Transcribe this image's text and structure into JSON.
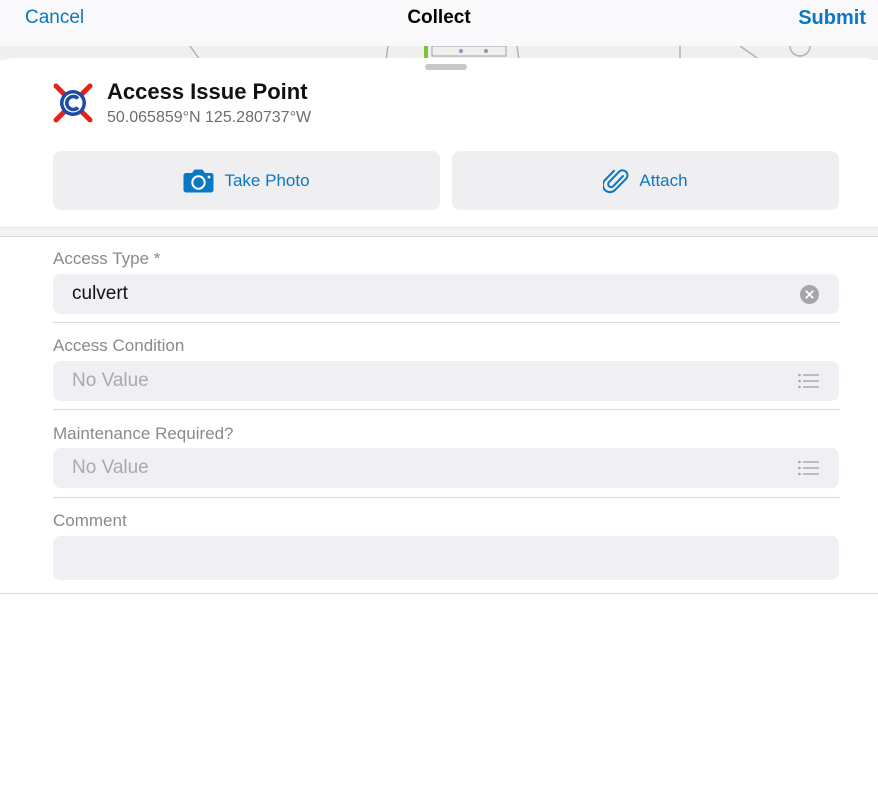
{
  "navbar": {
    "cancel_label": "Cancel",
    "title": "Collect",
    "submit_label": "Submit"
  },
  "feature": {
    "title": "Access Issue Point",
    "coordinates": "50.065859°N  125.280737°W",
    "icon": "access-issue-symbol-icon"
  },
  "actions": [
    {
      "label": "Take Photo",
      "icon": "camera-icon"
    },
    {
      "label": "Attach",
      "icon": "paperclip-icon"
    }
  ],
  "fields": [
    {
      "label": "Access Type *",
      "value": "culvert",
      "placeholder": "",
      "control": "clear-icon"
    },
    {
      "label": "Access Condition",
      "value": "",
      "placeholder": "No Value",
      "control": "list-icon"
    },
    {
      "label": "Maintenance Required?",
      "value": "",
      "placeholder": "No Value",
      "control": "list-icon"
    },
    {
      "label": "Comment",
      "value": "",
      "placeholder": "",
      "control": ""
    }
  ],
  "colors": {
    "accent": "#0a78c2",
    "field_background": "#efeff4",
    "label_gray": "#8a8a8e",
    "symbol_red": "#e2231a",
    "symbol_blue": "#1e4aa8"
  }
}
